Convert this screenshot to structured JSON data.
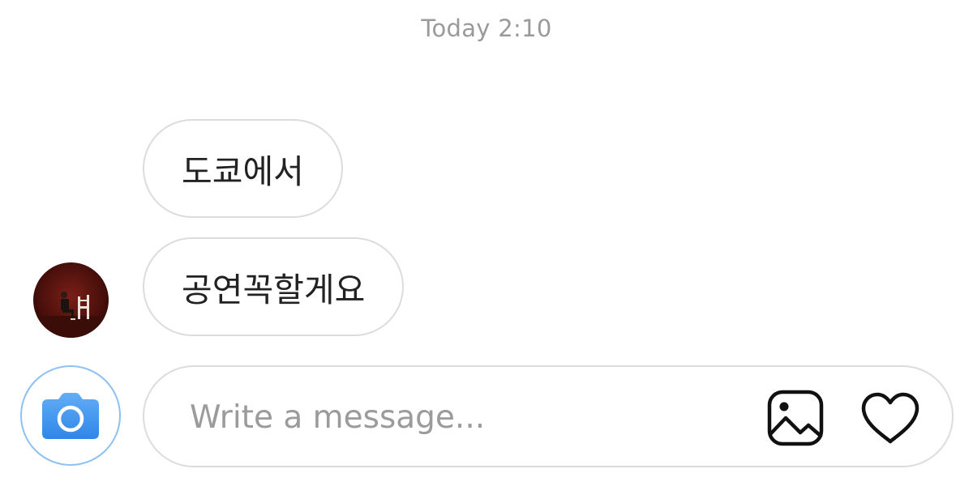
{
  "conversation": {
    "timestamp": "Today 2:10",
    "messages": [
      {
        "text": "도쿄에서",
        "direction": "incoming"
      },
      {
        "text": "공연꼭할게요",
        "direction": "incoming"
      }
    ]
  },
  "sender": {
    "avatar_icon": "profile-photo"
  },
  "composer": {
    "placeholder": "Write a message...",
    "camera_icon": "camera-icon",
    "gallery_icon": "image-icon",
    "like_icon": "heart-icon"
  },
  "colors": {
    "accent_blue": "#3f97f0",
    "bubble_border": "#dcdcdc",
    "placeholder_gray": "#9b9b9b",
    "timestamp_gray": "#9a9a9a"
  }
}
